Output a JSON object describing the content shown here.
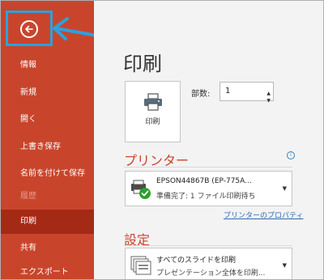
{
  "sidebar": {
    "items": [
      {
        "label": "情報"
      },
      {
        "label": "新規"
      },
      {
        "label": "開く"
      },
      {
        "label": "上書き保存"
      },
      {
        "label": "名前を付けて保存"
      },
      {
        "label": "履歴"
      },
      {
        "label": "印刷"
      },
      {
        "label": "共有"
      },
      {
        "label": "エクスポート"
      }
    ]
  },
  "main": {
    "title": "印刷",
    "print_button_label": "印刷",
    "copies_label": "部数:",
    "copies_value": "1",
    "printer_section_title": "プリンター",
    "printer": {
      "name": "EPSON44867B (EP-775A...",
      "status": "準備完了: 1 ファイル印刷待ち"
    },
    "printer_properties_link": "プリンターのプロパティ",
    "settings_section_title": "設定",
    "slides_option": {
      "title": "すべてのスライドを印刷",
      "subtitle": "プレゼンテーション全体を印刷..."
    }
  }
}
